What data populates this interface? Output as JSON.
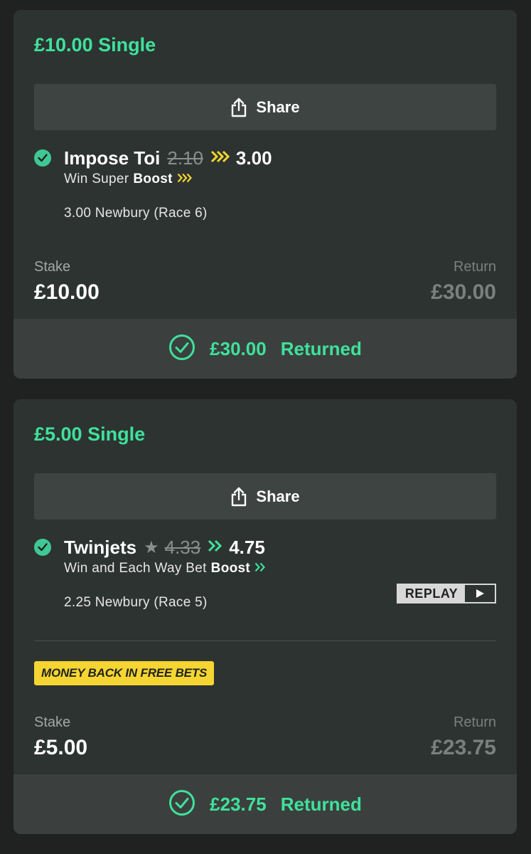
{
  "bets": [
    {
      "title": "£10.00 Single",
      "share_label": "Share",
      "runner": "Impose Toi",
      "old_odds": "2.10",
      "new_odds": "3.00",
      "boost_prefix": "Win Super",
      "boost_word": "Boost",
      "race": "3.00 Newbury (Race 6)",
      "stake_label": "Stake",
      "stake_value": "£10.00",
      "return_label": "Return",
      "return_value": "£30.00",
      "returned_amount": "£30.00",
      "returned_text": "Returned",
      "boost_color": "#f5d531"
    },
    {
      "title": "£5.00 Single",
      "share_label": "Share",
      "runner": "Twinjets",
      "old_odds": "4.33",
      "new_odds": "4.75",
      "boost_prefix": "Win and Each Way Bet",
      "boost_word": "Boost",
      "race": "2.25 Newbury (Race 5)",
      "replay_label": "REPLAY",
      "promo": "MONEY BACK IN FREE BETS",
      "stake_label": "Stake",
      "stake_value": "£5.00",
      "return_label": "Return",
      "return_value": "£23.75",
      "returned_amount": "£23.75",
      "returned_text": "Returned",
      "boost_color": "#3fe19c"
    }
  ],
  "colors": {
    "accent_green": "#3fe19c",
    "boost_yellow": "#f5d531",
    "background": "#1f2221",
    "card": "#2d3331"
  }
}
